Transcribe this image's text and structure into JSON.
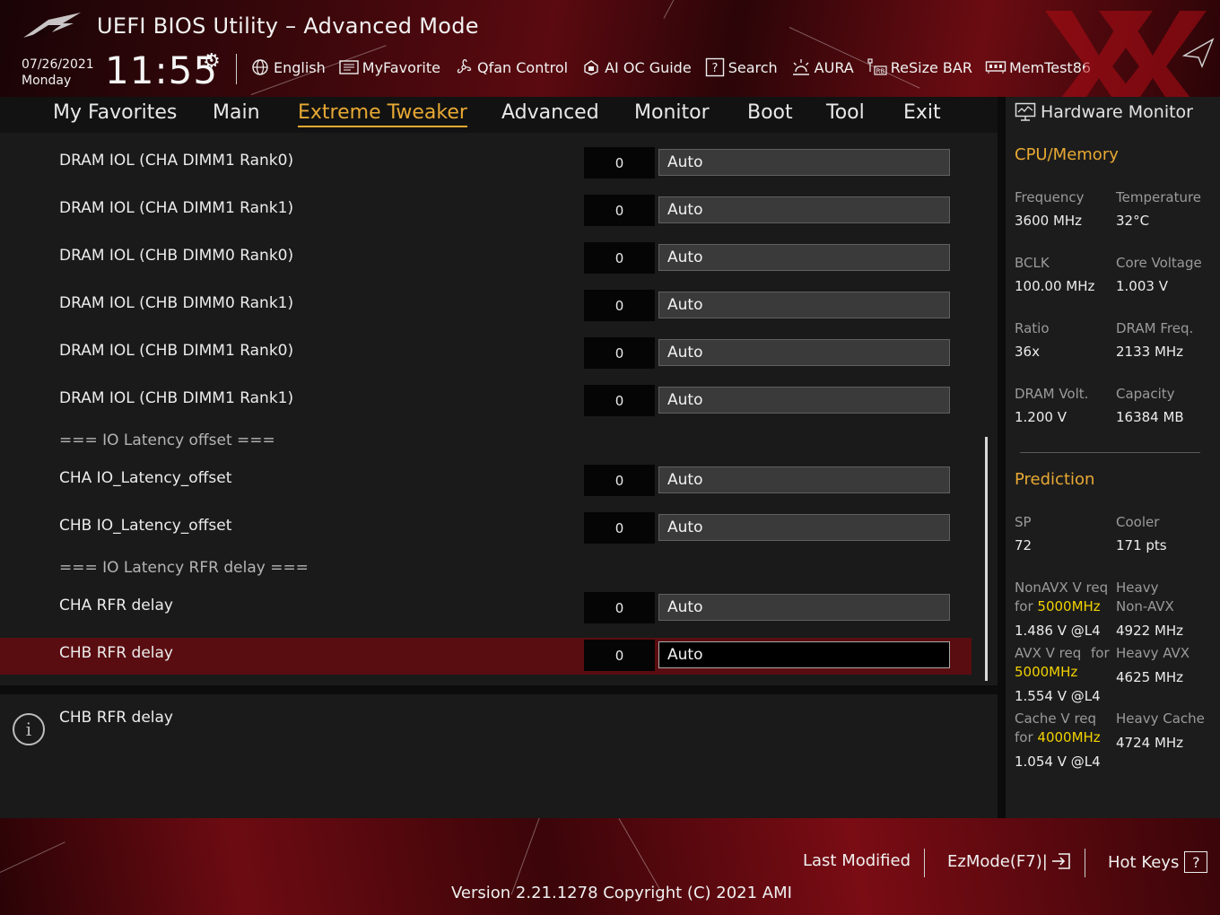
{
  "header": {
    "title": "UEFI BIOS Utility – Advanced Mode",
    "date": "07/26/2021",
    "day": "Monday",
    "time": "11:55",
    "tools": [
      {
        "label": "English",
        "icon": "globe-icon"
      },
      {
        "label": "MyFavorite",
        "icon": "favorite-list-icon"
      },
      {
        "label": "Qfan Control",
        "icon": "fan-icon"
      },
      {
        "label": "AI OC Guide",
        "icon": "ai-chip-icon"
      },
      {
        "label": "Search",
        "icon": "question-box-icon"
      },
      {
        "label": "AURA",
        "icon": "light-icon"
      },
      {
        "label": "ReSize BAR",
        "icon": "resize-bar-icon"
      },
      {
        "label": "MemTest86",
        "icon": "memory-icon"
      }
    ]
  },
  "nav": {
    "tabs": [
      "My Favorites",
      "Main",
      "Extreme Tweaker",
      "Advanced",
      "Monitor",
      "Boot",
      "Tool",
      "Exit"
    ],
    "active": "Extreme Tweaker"
  },
  "settings": {
    "rows": [
      {
        "label": "DRAM IOL (CHA DIMM1 Rank0)",
        "value": "0",
        "option": "Auto"
      },
      {
        "label": "DRAM IOL (CHA DIMM1 Rank1)",
        "value": "0",
        "option": "Auto"
      },
      {
        "label": "DRAM IOL (CHB DIMM0 Rank0)",
        "value": "0",
        "option": "Auto"
      },
      {
        "label": "DRAM IOL (CHB DIMM0 Rank1)",
        "value": "0",
        "option": "Auto"
      },
      {
        "label": "DRAM IOL (CHB DIMM1 Rank0)",
        "value": "0",
        "option": "Auto"
      },
      {
        "label": "DRAM IOL (CHB DIMM1 Rank1)",
        "value": "0",
        "option": "Auto"
      },
      {
        "label": "CHA IO_Latency_offset",
        "value": "0",
        "option": "Auto"
      },
      {
        "label": "CHB IO_Latency_offset",
        "value": "0",
        "option": "Auto"
      },
      {
        "label": "CHA RFR delay",
        "value": "0",
        "option": "Auto"
      },
      {
        "label": "CHB RFR delay",
        "value": "0",
        "option": "Auto"
      }
    ],
    "section_io_latency": "=== IO Latency offset ===",
    "section_rfr": "=== IO Latency RFR delay ===",
    "selected": "CHB RFR delay"
  },
  "help": {
    "text": "CHB RFR delay"
  },
  "monitor": {
    "title": "Hardware Monitor",
    "cpu_section": "CPU/Memory",
    "cpu": [
      {
        "label": "Frequency",
        "value": "3600 MHz"
      },
      {
        "label": "Temperature",
        "value": "32°C"
      },
      {
        "label": "BCLK",
        "value": "100.00 MHz"
      },
      {
        "label": "Core Voltage",
        "value": "1.003 V"
      },
      {
        "label": "Ratio",
        "value": "36x"
      },
      {
        "label": "DRAM Freq.",
        "value": "2133 MHz"
      },
      {
        "label": "DRAM Volt.",
        "value": "1.200 V"
      },
      {
        "label": "Capacity",
        "value": "16384 MB"
      }
    ],
    "prediction_section": "Prediction",
    "sp_label": "SP",
    "sp_value": "72",
    "cooler_label": "Cooler",
    "cooler_value": "171 pts",
    "nonavx_label": "NonAVX V req",
    "nonavx_for": "for",
    "nonavx_freq": "5000MHz",
    "nonavx_value": "1.486 V @L4",
    "heavy_nonavx_label_1": "Heavy",
    "heavy_nonavx_label_2": "Non-AVX",
    "heavy_nonavx_value": "4922 MHz",
    "avx_label": "AVX V req",
    "avx_for": "for",
    "avx_freq": "5000MHz",
    "avx_value": "1.554 V @L4",
    "heavy_avx_label": "Heavy AVX",
    "heavy_avx_value": "4625 MHz",
    "cache_label": "Cache V req",
    "cache_for": "for",
    "cache_freq": "4000MHz",
    "cache_value": "1.054 V @L4",
    "heavy_cache_label": "Heavy Cache",
    "heavy_cache_value": "4724 MHz"
  },
  "footer": {
    "last_modified": "Last Modified",
    "ezmode": "EzMode(F7)|",
    "hotkeys": "Hot Keys",
    "hotkeys_key": "?",
    "version": "Version 2.21.1278 Copyright (C) 2021 AMI"
  },
  "colors": {
    "accent": "#e8a934",
    "highlight_row": "#5a0d11",
    "prediction_highlight": "#f2d200"
  }
}
